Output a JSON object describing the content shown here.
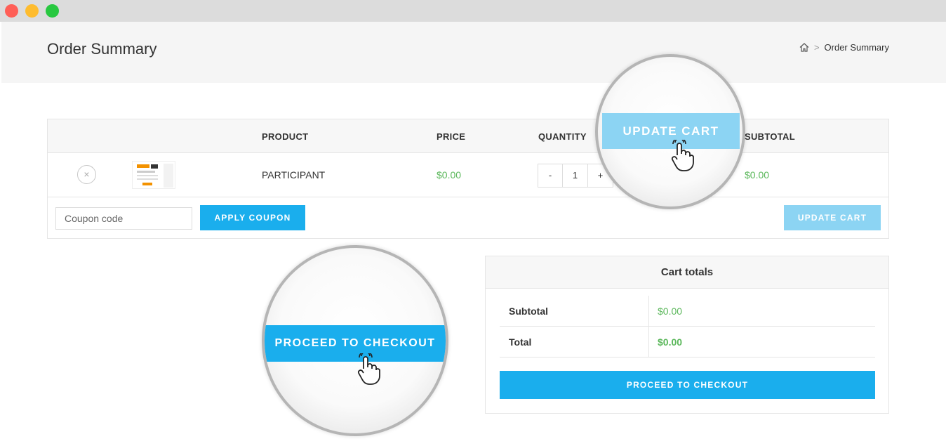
{
  "page": {
    "title": "Order Summary",
    "breadcrumb": {
      "home_icon": "home-icon",
      "separator": ">",
      "current": "Order Summary"
    }
  },
  "cart": {
    "headers": {
      "product": "PRODUCT",
      "price": "PRICE",
      "quantity": "QUANTITY",
      "subtotal": "SUBTOTAL"
    },
    "items": [
      {
        "remove_symbol": "×",
        "name": "PARTICIPANT",
        "price": "$0.00",
        "quantity": "1",
        "subtotal": "$0.00"
      }
    ],
    "qty_minus": "-",
    "qty_plus": "+",
    "coupon_placeholder": "Coupon code",
    "apply_coupon_label": "APPLY COUPON",
    "update_cart_label": "UPDATE CART"
  },
  "totals": {
    "heading": "Cart totals",
    "subtotal_label": "Subtotal",
    "subtotal_value": "$0.00",
    "total_label": "Total",
    "total_value": "$0.00",
    "checkout_label": "PROCEED TO CHECKOUT"
  },
  "magnifiers": {
    "update_cart_label": "UPDATE CART",
    "checkout_label": "PROCEED TO CHECKOUT",
    "cursor_icon": "hand-pointer-icon"
  },
  "colors": {
    "accent": "#1aaeed",
    "accent_disabled": "#8cd4f3",
    "price_green": "#5cb85c"
  }
}
